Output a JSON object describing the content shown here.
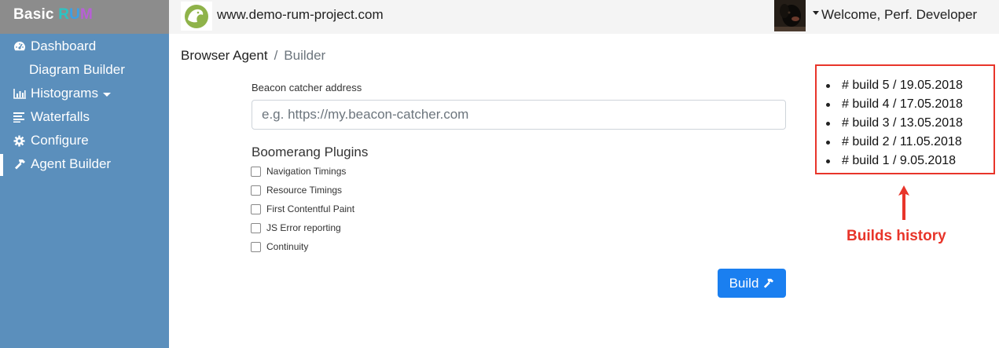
{
  "brand": {
    "part1": "Basic ",
    "r": "R",
    "u": "U",
    "m": "M"
  },
  "sidebar": {
    "items": [
      {
        "label": "Dashboard",
        "icon": "dashboard-icon"
      },
      {
        "label": "Diagram Builder",
        "icon": ""
      },
      {
        "label": "Histograms",
        "icon": "histogram-icon",
        "dropdown": true
      },
      {
        "label": "Waterfalls",
        "icon": "waterfall-icon"
      },
      {
        "label": "Configure",
        "icon": "gear-icon"
      },
      {
        "label": "Agent Builder",
        "icon": "hammer-icon",
        "active": true
      }
    ]
  },
  "topbar": {
    "domain": "www.demo-rum-project.com",
    "welcome": "Welcome, Perf. Developer"
  },
  "breadcrumb": {
    "first": "Browser Agent",
    "separator": "/",
    "current": "Builder"
  },
  "form": {
    "beacon_label": "Beacon catcher address",
    "beacon_placeholder": "e.g. https://my.beacon-catcher.com",
    "plugins_title": "Boomerang Plugins",
    "plugins": [
      "Navigation Timings",
      "Resource Timings",
      "First Contentful Paint",
      "JS Error reporting",
      "Continuity"
    ],
    "build_label": "Build"
  },
  "history": {
    "builds": [
      "# build 5 / 19.05.2018",
      "# build 4 / 17.05.2018",
      "# build 3 / 13.05.2018",
      "# build 2 / 11.05.2018",
      "# build 1 / 9.05.2018"
    ],
    "caption": "Builds history"
  },
  "colors": {
    "sidebar": "#5b8fbc",
    "brand_bg": "#8c8c8c",
    "primary": "#1a7ff0",
    "annotation": "#e8352a"
  }
}
